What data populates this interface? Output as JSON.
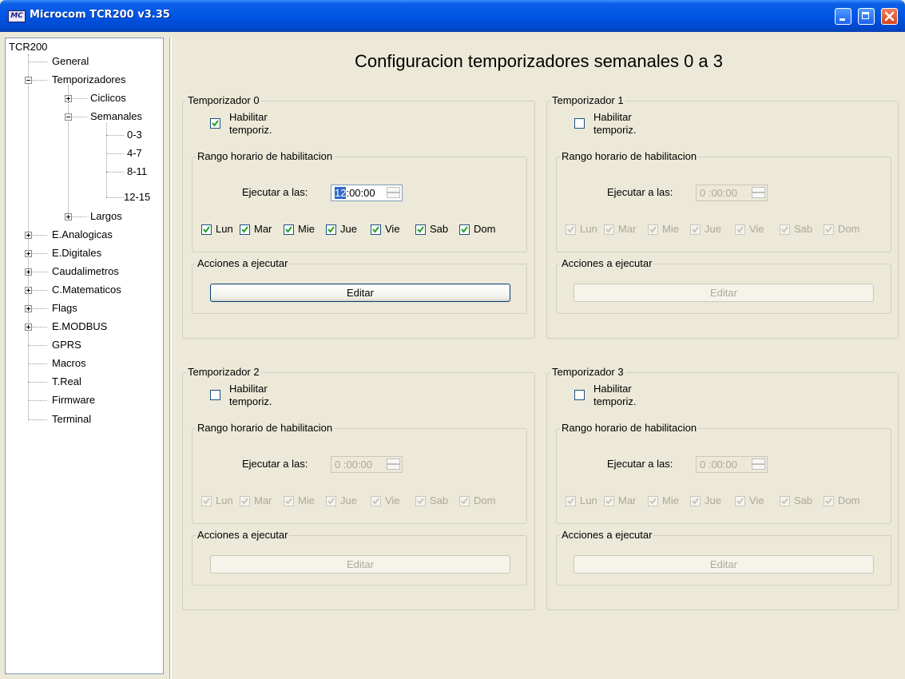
{
  "window": {
    "title": "Microcom TCR200 v3.35",
    "icon_text": "MC"
  },
  "tree": {
    "root": "TCR200",
    "items": [
      {
        "label": "General"
      },
      {
        "label": "Temporizadores"
      },
      {
        "label": "Ciclicos"
      },
      {
        "label": "Semanales"
      },
      {
        "label": "0-3"
      },
      {
        "label": "4-7"
      },
      {
        "label": "8-11"
      },
      {
        "label": "12-15"
      },
      {
        "label": "Largos"
      },
      {
        "label": "E.Analogicas"
      },
      {
        "label": "E.Digitales"
      },
      {
        "label": "Caudalimetros"
      },
      {
        "label": "C.Matematicos"
      },
      {
        "label": "Flags"
      },
      {
        "label": "E.MODBUS"
      },
      {
        "label": "GPRS"
      },
      {
        "label": "Macros"
      },
      {
        "label": "T.Real"
      },
      {
        "label": "Firmware"
      },
      {
        "label": "Terminal"
      }
    ]
  },
  "page_title": "Configuracion temporizadores semanales  0 a 3",
  "timers": [
    {
      "title": "Temporizador  0",
      "enabled": true,
      "enable_label_1": "Habilitar",
      "enable_label_2": "temporiz.",
      "range_title": "Rango horario de habilitacion",
      "exec_label": "Ejecutar a las:",
      "time_sel": "12",
      "time_rest": ":00:00",
      "days": [
        "Lun",
        "Mar",
        "Mie",
        "Jue",
        "Vie",
        "Sab",
        "Dom"
      ],
      "actions_title": "Acciones a ejecutar",
      "edit_label": "Editar"
    },
    {
      "title": "Temporizador  1",
      "enabled": false,
      "enable_label_1": "Habilitar",
      "enable_label_2": "temporiz.",
      "range_title": "Rango horario de habilitacion",
      "exec_label": "Ejecutar a las:",
      "time_sel": "",
      "time_rest": "0 :00:00",
      "days": [
        "Lun",
        "Mar",
        "Mie",
        "Jue",
        "Vie",
        "Sab",
        "Dom"
      ],
      "actions_title": "Acciones a ejecutar",
      "edit_label": "Editar"
    },
    {
      "title": "Temporizador  2",
      "enabled": false,
      "enable_label_1": "Habilitar",
      "enable_label_2": "temporiz.",
      "range_title": "Rango horario de habilitacion",
      "exec_label": "Ejecutar a las:",
      "time_sel": "",
      "time_rest": "0 :00:00",
      "days": [
        "Lun",
        "Mar",
        "Mie",
        "Jue",
        "Vie",
        "Sab",
        "Dom"
      ],
      "actions_title": "Acciones a ejecutar",
      "edit_label": "Editar"
    },
    {
      "title": "Temporizador  3",
      "enabled": false,
      "enable_label_1": "Habilitar",
      "enable_label_2": "temporiz.",
      "range_title": "Rango horario de habilitacion",
      "exec_label": "Ejecutar a las:",
      "time_sel": "",
      "time_rest": "0 :00:00",
      "days": [
        "Lun",
        "Mar",
        "Mie",
        "Jue",
        "Vie",
        "Sab",
        "Dom"
      ],
      "actions_title": "Acciones a ejecutar",
      "edit_label": "Editar"
    }
  ]
}
